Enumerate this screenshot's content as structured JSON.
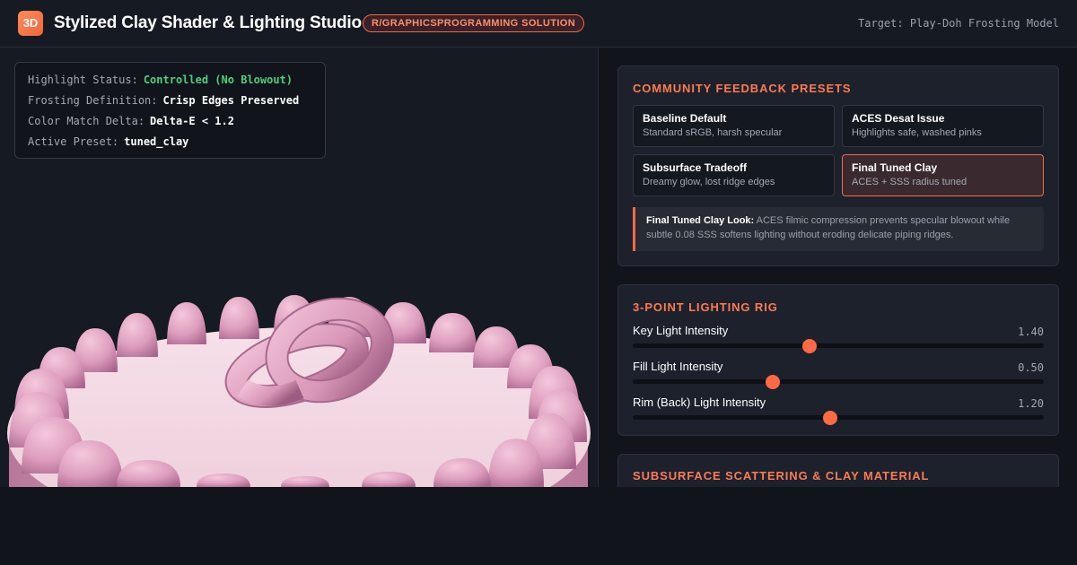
{
  "header": {
    "logo": "3D",
    "title": "Stylized Clay Shader & Lighting Studio",
    "badge": "R/GRAPHICSPROGRAMMING SOLUTION",
    "target": "Target: Play-Doh Frosting Model"
  },
  "status": [
    {
      "key": "Highlight Status:",
      "value": "Controlled (No Blowout)",
      "color": "#4cd080"
    },
    {
      "key": "Frosting Definition:",
      "value": "Crisp Edges Preserved"
    },
    {
      "key": "Color Match Delta:",
      "value": "Delta-E < 1.2"
    },
    {
      "key": "Active Preset:",
      "value": "tuned_clay"
    }
  ],
  "presets_panel": {
    "title": "COMMUNITY FEEDBACK PRESETS",
    "presets": [
      {
        "name": "Baseline Default",
        "desc": "Standard sRGB, harsh specular",
        "active": false
      },
      {
        "name": "ACES Desat Issue",
        "desc": "Highlights safe, washed pinks",
        "active": false
      },
      {
        "name": "Subsurface Tradeoff",
        "desc": "Dreamy glow, lost ridge edges",
        "active": false
      },
      {
        "name": "Final Tuned Clay",
        "desc": "ACES + SSS radius tuned",
        "active": true
      }
    ],
    "note_bold": "Final Tuned Clay Look:",
    "note_text": " ACES filmic compression prevents specular blowout while subtle 0.08 SSS softens lighting without eroding delicate piping ridges."
  },
  "lighting_panel": {
    "title": "3-POINT LIGHTING RIG",
    "sliders": [
      {
        "label": "Key Light Intensity",
        "display": "1.40",
        "fraction": 0.43
      },
      {
        "label": "Fill Light Intensity",
        "display": "0.50",
        "fraction": 0.34
      },
      {
        "label": "Rim (Back) Light Intensity",
        "display": "1.20",
        "fraction": 0.48
      }
    ]
  },
  "material_panel": {
    "title": "SUBSURFACE SCATTERING & CLAY MATERIAL"
  },
  "colors": {
    "accent": "#ff6a44",
    "frosting": "#e8a9c6",
    "cake_top": "#f2d7e2"
  }
}
